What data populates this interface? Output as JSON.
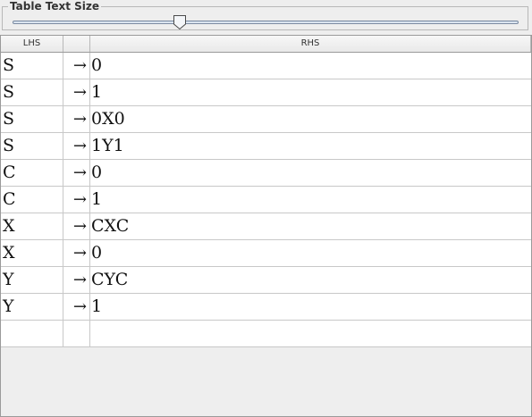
{
  "size_panel": {
    "title": "Table Text Size",
    "slider_value_fraction": 0.33
  },
  "table": {
    "headers": [
      "LHS",
      "",
      "RHS"
    ],
    "rows": [
      {
        "lhs": "S",
        "arrow": "→",
        "rhs": "0"
      },
      {
        "lhs": "S",
        "arrow": "→",
        "rhs": "1"
      },
      {
        "lhs": "S",
        "arrow": "→",
        "rhs": "0X0"
      },
      {
        "lhs": "S",
        "arrow": "→",
        "rhs": "1Y1"
      },
      {
        "lhs": "C",
        "arrow": "→",
        "rhs": "0"
      },
      {
        "lhs": "C",
        "arrow": "→",
        "rhs": "1"
      },
      {
        "lhs": "X",
        "arrow": "→",
        "rhs": "CXC"
      },
      {
        "lhs": "X",
        "arrow": "→",
        "rhs": "0"
      },
      {
        "lhs": "Y",
        "arrow": "→",
        "rhs": "CYC"
      },
      {
        "lhs": "Y",
        "arrow": "→",
        "rhs": "1"
      },
      {
        "lhs": "",
        "arrow": "",
        "rhs": ""
      }
    ]
  }
}
